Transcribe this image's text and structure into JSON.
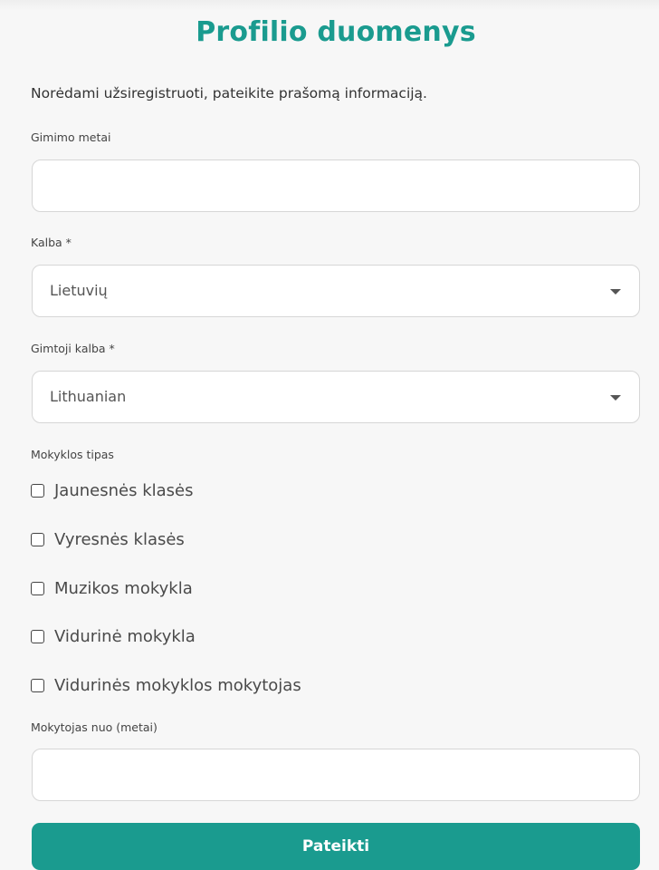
{
  "page": {
    "title": "Profilio duomenys",
    "intro": "Norėdami užsiregistruoti, pateikite prašomą informaciją."
  },
  "colors": {
    "accent": "#1a9b8f",
    "background": "#f7f7f7",
    "field_border": "#d6d6d6"
  },
  "form": {
    "birth_year": {
      "label": "Gimimo metai",
      "value": ""
    },
    "language": {
      "label": "Kalba *",
      "selected": "Lietuvių",
      "icon": "caret-down-icon"
    },
    "native_language": {
      "label": "Gimtoji kalba *",
      "selected": "Lithuanian",
      "icon": "caret-down-icon"
    },
    "school_type": {
      "label": "Mokyklos tipas",
      "options": [
        {
          "label": "Jaunesnės klasės",
          "checked": false
        },
        {
          "label": "Vyresnės klasės",
          "checked": false
        },
        {
          "label": "Muzikos mokykla",
          "checked": false
        },
        {
          "label": "Vidurinė mokykla",
          "checked": false
        },
        {
          "label": "Vidurinės mokyklos mokytojas",
          "checked": false
        }
      ]
    },
    "teacher_since": {
      "label": "Mokytojas nuo (metai)",
      "value": ""
    },
    "submit_label": "Pateikti"
  }
}
